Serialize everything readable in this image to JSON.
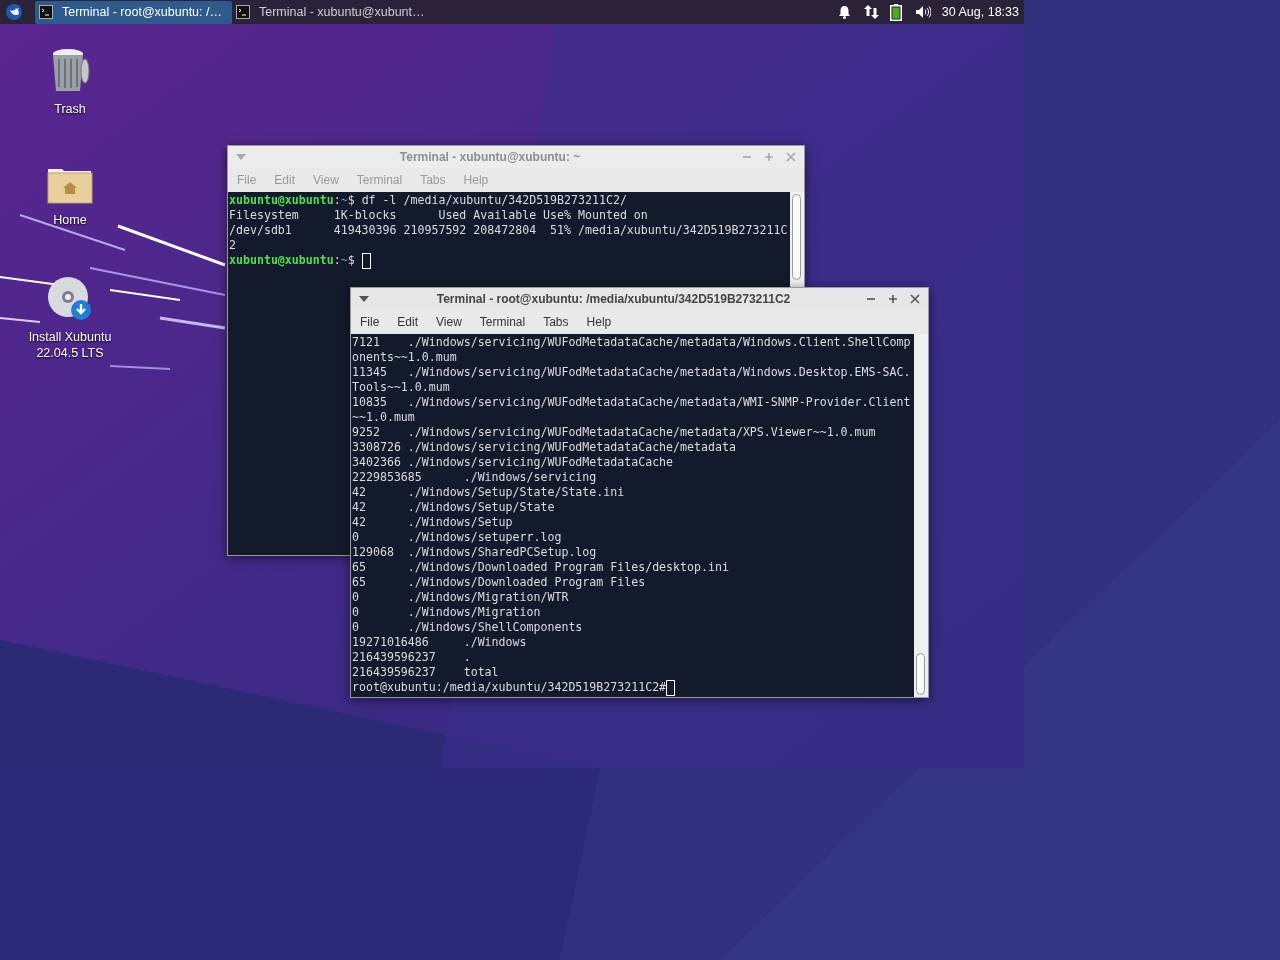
{
  "taskbar": {
    "tasks": [
      {
        "label": "Terminal - root@xubuntu: /…",
        "selected": true
      },
      {
        "label": "Terminal - xubuntu@xubunt…",
        "selected": false
      }
    ],
    "clock": "30 Aug, 18:33"
  },
  "desktop_icons": [
    {
      "kind": "trash",
      "lines": [
        "Trash"
      ]
    },
    {
      "kind": "home",
      "lines": [
        "Home"
      ]
    },
    {
      "kind": "installer",
      "lines": [
        "Install Xubuntu",
        "22.04.5 LTS"
      ]
    }
  ],
  "windows": [
    {
      "title": "Terminal - xubuntu@xubuntu: ~",
      "active": false,
      "menu": [
        "File",
        "Edit",
        "View",
        "Terminal",
        "Tabs",
        "Help"
      ],
      "lines": [
        {
          "kind": "prompt",
          "user": "xubuntu@xubuntu",
          "separator": ":",
          "path": "~",
          "symbol": "$",
          "command": "df -l /media/xubuntu/342D519B273211C2/"
        },
        {
          "kind": "output",
          "text": "Filesystem     1K-blocks      Used Available Use% Mounted on",
          "cursor": false
        },
        {
          "kind": "output",
          "text": "/dev/sdb1      419430396 210957592 208472804  51% /media/xubuntu/342D519B273211C",
          "cursor": false
        },
        {
          "kind": "output",
          "text": "2",
          "cursor": false
        },
        {
          "kind": "prompt",
          "user": "xubuntu@xubuntu",
          "separator": ":",
          "path": "~",
          "symbol": "$",
          "cursor": true
        }
      ]
    },
    {
      "title": "Terminal - root@xubuntu: /media/xubuntu/342D519B273211C2",
      "active": true,
      "menu": [
        "File",
        "Edit",
        "View",
        "Terminal",
        "Tabs",
        "Help"
      ],
      "lines": [
        {
          "kind": "output",
          "text": "7121    ./Windows/servicing/WUFodMetadataCache/metadata/Windows.Client.ShellComp",
          "cursor": false
        },
        {
          "kind": "output",
          "text": "onents~~1.0.mum",
          "cursor": false
        },
        {
          "kind": "output",
          "text": "11345   ./Windows/servicing/WUFodMetadataCache/metadata/Windows.Desktop.EMS-SAC.",
          "cursor": false
        },
        {
          "kind": "output",
          "text": "Tools~~1.0.mum",
          "cursor": false
        },
        {
          "kind": "output",
          "text": "10835   ./Windows/servicing/WUFodMetadataCache/metadata/WMI-SNMP-Provider.Client",
          "cursor": false
        },
        {
          "kind": "output",
          "text": "~~1.0.mum",
          "cursor": false
        },
        {
          "kind": "output",
          "text": "9252    ./Windows/servicing/WUFodMetadataCache/metadata/XPS.Viewer~~1.0.mum",
          "cursor": false
        },
        {
          "kind": "output",
          "text": "3308726 ./Windows/servicing/WUFodMetadataCache/metadata",
          "cursor": false
        },
        {
          "kind": "output",
          "text": "3402366 ./Windows/servicing/WUFodMetadataCache",
          "cursor": false
        },
        {
          "kind": "output",
          "text": "2229853685      ./Windows/servicing",
          "cursor": false
        },
        {
          "kind": "output",
          "text": "42      ./Windows/Setup/State/State.ini",
          "cursor": false
        },
        {
          "kind": "output",
          "text": "42      ./Windows/Setup/State",
          "cursor": false
        },
        {
          "kind": "output",
          "text": "42      ./Windows/Setup",
          "cursor": false
        },
        {
          "kind": "output",
          "text": "0       ./Windows/setuperr.log",
          "cursor": false
        },
        {
          "kind": "output",
          "text": "129068  ./Windows/SharedPCSetup.log",
          "cursor": false
        },
        {
          "kind": "output",
          "text": "65      ./Windows/Downloaded Program Files/desktop.ini",
          "cursor": false
        },
        {
          "kind": "output",
          "text": "65      ./Windows/Downloaded Program Files",
          "cursor": false
        },
        {
          "kind": "output",
          "text": "0       ./Windows/Migration/WTR",
          "cursor": false
        },
        {
          "kind": "output",
          "text": "0       ./Windows/Migration",
          "cursor": false
        },
        {
          "kind": "output",
          "text": "0       ./Windows/ShellComponents",
          "cursor": false
        },
        {
          "kind": "output",
          "text": "19271016486     ./Windows",
          "cursor": false
        },
        {
          "kind": "output",
          "text": "216439596237    .",
          "cursor": false
        },
        {
          "kind": "output",
          "text": "216439596237    total",
          "cursor": false
        },
        {
          "kind": "output",
          "text": "root@xubuntu:/media/xubuntu/342D519B273211C2#",
          "cursor": true
        }
      ]
    }
  ]
}
